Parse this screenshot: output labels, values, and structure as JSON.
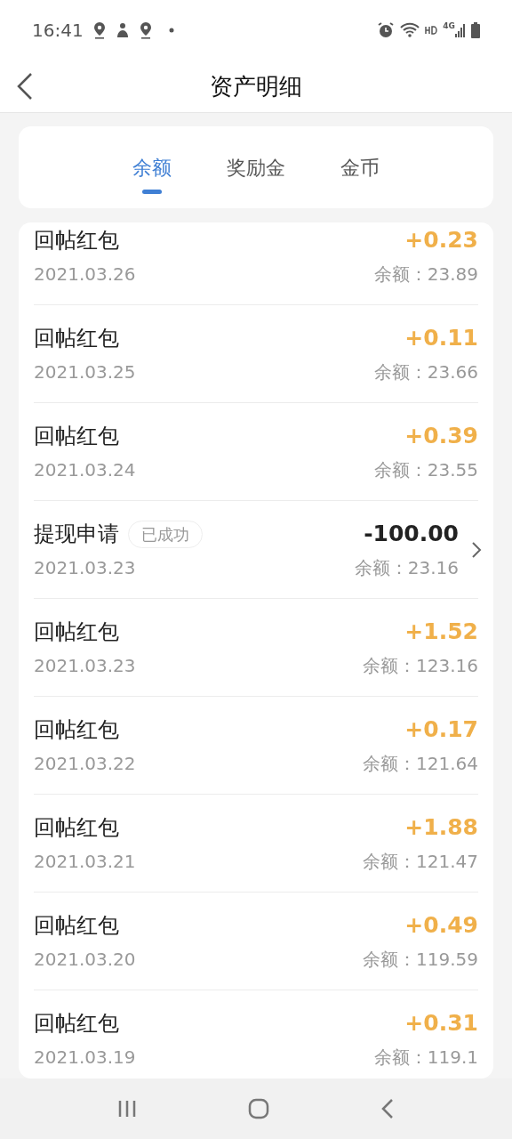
{
  "status_bar": {
    "time": "16:41",
    "network": "4G"
  },
  "header": {
    "title": "资产明细"
  },
  "tabs": [
    {
      "label": "余额",
      "selected": true
    },
    {
      "label": "奖励金",
      "selected": false
    },
    {
      "label": "金币",
      "selected": false
    }
  ],
  "rows": [
    {
      "kind": "reward",
      "title": "回帖红包",
      "date": "2021.03.26",
      "amount": "+0.23",
      "balance": "余额：23.89"
    },
    {
      "kind": "reward",
      "title": "回帖红包",
      "date": "2021.03.25",
      "amount": "+0.11",
      "balance": "余额：23.66"
    },
    {
      "kind": "reward",
      "title": "回帖红包",
      "date": "2021.03.24",
      "amount": "+0.39",
      "balance": "余额：23.55"
    },
    {
      "kind": "withdrawal",
      "title": "提现申请",
      "badge": "已成功",
      "date": "2021.03.23",
      "amount": "-100.00",
      "balance": "余额：23.16"
    },
    {
      "kind": "reward",
      "title": "回帖红包",
      "date": "2021.03.23",
      "amount": "+1.52",
      "balance": "余额：123.16"
    },
    {
      "kind": "reward",
      "title": "回帖红包",
      "date": "2021.03.22",
      "amount": "+0.17",
      "balance": "余额：121.64"
    },
    {
      "kind": "reward",
      "title": "回帖红包",
      "date": "2021.03.21",
      "amount": "+1.88",
      "balance": "余额：121.47"
    },
    {
      "kind": "reward",
      "title": "回帖红包",
      "date": "2021.03.20",
      "amount": "+0.49",
      "balance": "余额：119.59"
    },
    {
      "kind": "reward",
      "title": "回帖红包",
      "date": "2021.03.19",
      "amount": "+0.31",
      "balance": "余额：119.1"
    }
  ]
}
